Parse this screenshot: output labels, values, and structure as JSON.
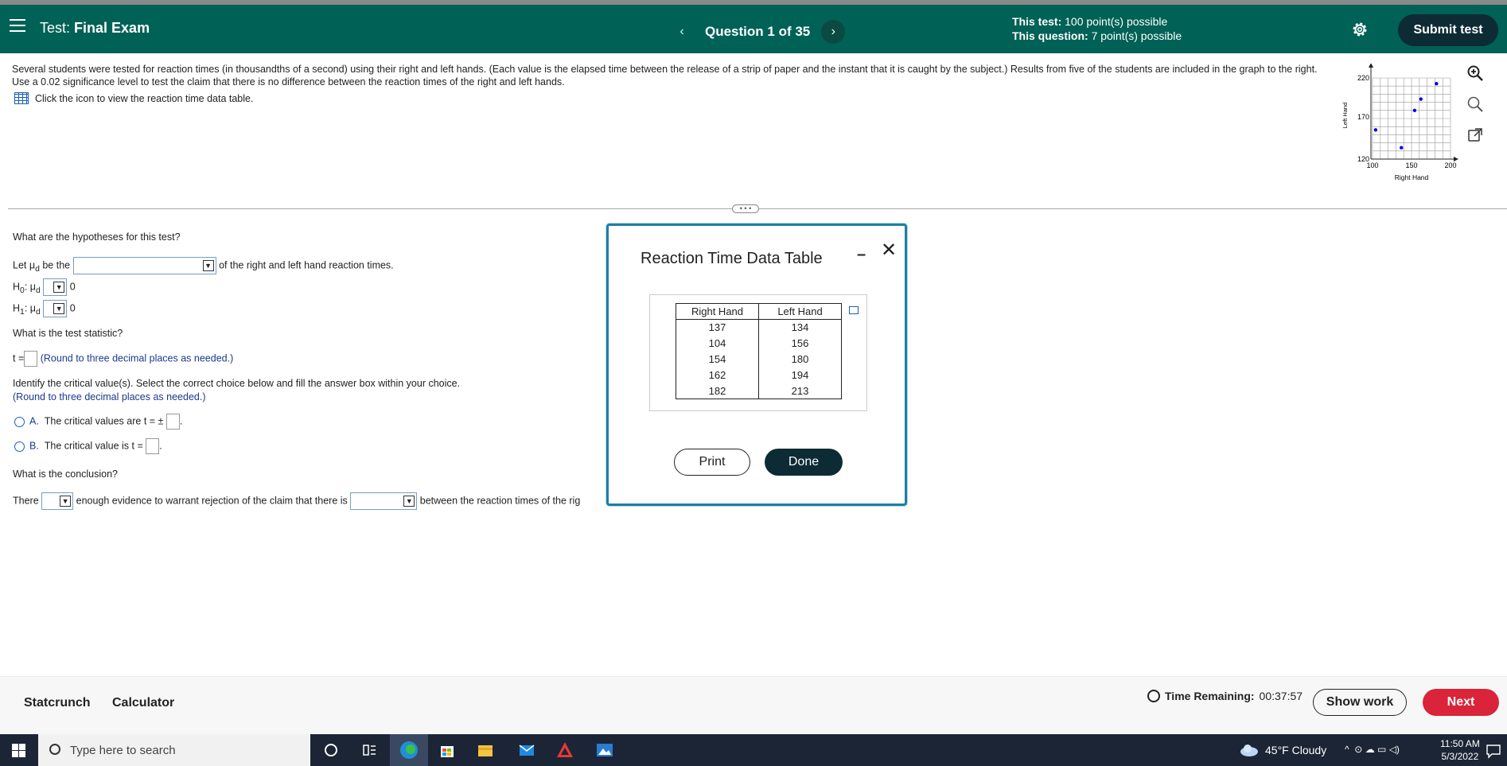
{
  "header": {
    "title_prefix": "Test:",
    "title": "Final Exam",
    "question_label": "Question 1 of 35",
    "prev_symbol": "‹",
    "next_symbol": "›",
    "test_points_label": "This test:",
    "test_points_value": "100 point(s) possible",
    "question_points_label": "This question:",
    "question_points_value": "7 point(s) possible",
    "submit_label": "Submit test"
  },
  "problem": {
    "text": "Several students were tested for reaction times (in thousandths of a second) using their right and left hands. (Each value is the elapsed time between the release of a strip of paper and the instant that it is caught by the subject.) Results from five of the students are included in the graph to the right. Use a 0.02 significance level to test the claim that there is no difference between the reaction times of the right and left hands.",
    "data_link": "Click the icon to view the reaction time data table."
  },
  "graph": {
    "y_ticks": [
      "220",
      "170",
      "120"
    ],
    "x_ticks": [
      "100",
      "150",
      "200"
    ],
    "xlabel": "Right Hand",
    "ylabel": "Left Hand",
    "point_color": "#0000ee"
  },
  "chart_data": {
    "type": "scatter",
    "title": "",
    "xlabel": "Right Hand",
    "ylabel": "Left Hand",
    "xlim": [
      100,
      200
    ],
    "ylim": [
      120,
      220
    ],
    "x_ticks": [
      100,
      150,
      200
    ],
    "y_ticks": [
      120,
      170,
      220
    ],
    "grid": true,
    "points": [
      {
        "x": 137,
        "y": 134
      },
      {
        "x": 104,
        "y": 156
      },
      {
        "x": 154,
        "y": 180
      },
      {
        "x": 162,
        "y": 194
      },
      {
        "x": 182,
        "y": 213
      }
    ]
  },
  "questions": {
    "hyp_question": "What are the hypotheses for this test?",
    "let_prefix": "Let μ",
    "let_sub": "d",
    "let_mid": "be the",
    "let_suffix": "of the right and left hand reaction times.",
    "h0_label": "H",
    "h0_sub": "0",
    "h1_sub": "1",
    "mu_d": ": μ",
    "zero": "0",
    "stat_question": "What is the test statistic?",
    "t_prefix": "t =",
    "round_note": "(Round to three decimal places as needed.)",
    "crit_question": "Identify the critical value(s). Select the correct choice below and fill the answer box within your choice.",
    "choice_a_letter": "A.",
    "choice_a_text": "The critical values are t = ±",
    "choice_b_letter": "B.",
    "choice_b_text": "The critical value is t =",
    "conclusion_question": "What is the conclusion?",
    "there": "There",
    "enough_text": "enough evidence to warrant rejection of the claim that there is",
    "between_text": "between the reaction times of the rig"
  },
  "modal": {
    "title": "Reaction Time Data Table",
    "minimize": "–",
    "close": "✕",
    "columns": [
      "Right Hand",
      "Left Hand"
    ],
    "rows": [
      [
        "137",
        "134"
      ],
      [
        "104",
        "156"
      ],
      [
        "154",
        "180"
      ],
      [
        "162",
        "194"
      ],
      [
        "182",
        "213"
      ]
    ],
    "print_label": "Print",
    "done_label": "Done"
  },
  "footer": {
    "statcrunch": "Statcrunch",
    "calculator": "Calculator",
    "time_label": "Time Remaining:",
    "time_value": "00:37:57",
    "show_work": "Show work",
    "next": "Next"
  },
  "taskbar": {
    "search_placeholder": "Type here to search",
    "weather": "45°F  Cloudy",
    "time": "11:50 AM",
    "date": "5/3/2022"
  }
}
